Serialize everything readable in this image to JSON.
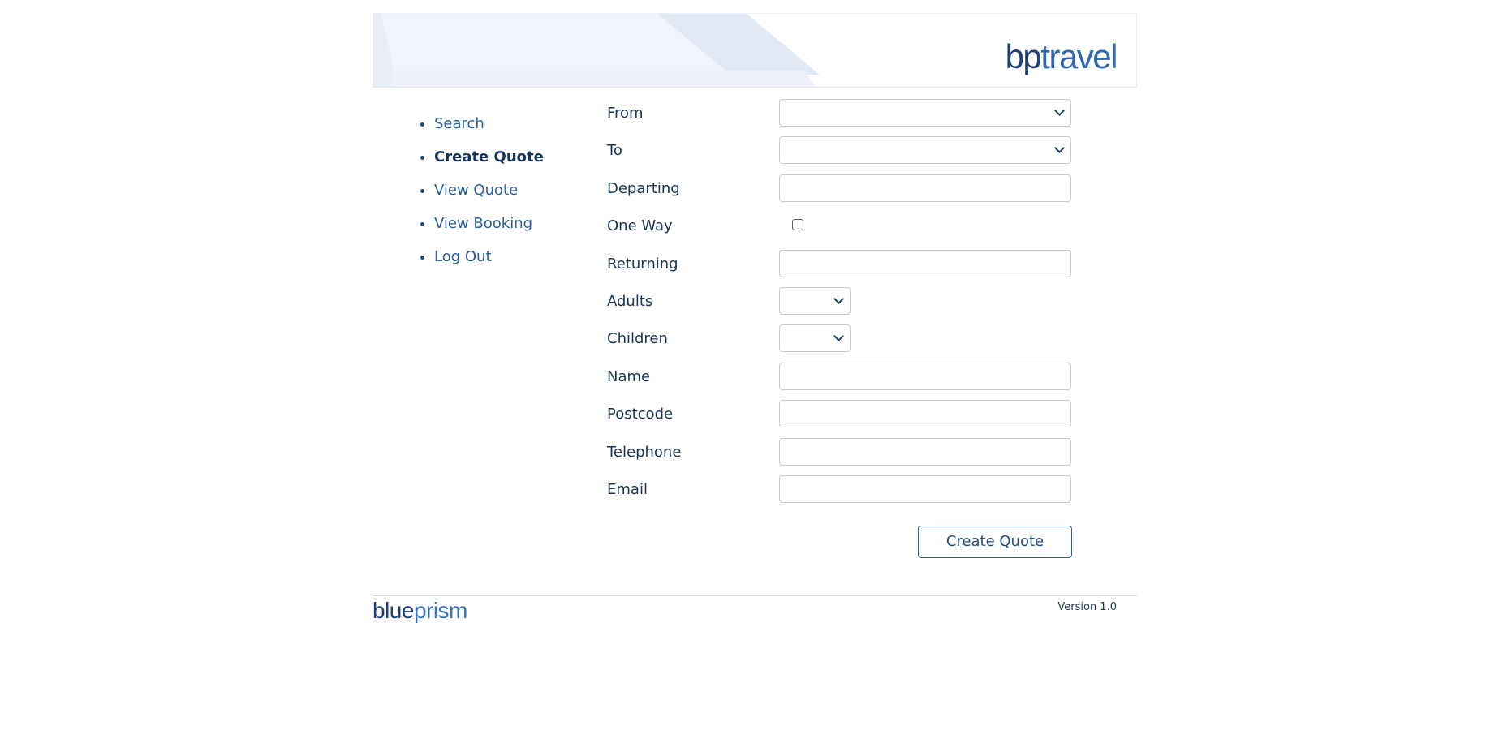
{
  "brand": {
    "part1": "bp",
    "part2": "travel"
  },
  "nav": {
    "items": [
      {
        "label": "Search",
        "active": false
      },
      {
        "label": "Create Quote",
        "active": true
      },
      {
        "label": "View Quote",
        "active": false
      },
      {
        "label": "View Booking",
        "active": false
      },
      {
        "label": "Log Out",
        "active": false
      }
    ]
  },
  "form": {
    "fields": [
      {
        "label": "From",
        "type": "select",
        "value": ""
      },
      {
        "label": "To",
        "type": "select",
        "value": ""
      },
      {
        "label": "Departing",
        "type": "text",
        "value": ""
      },
      {
        "label": "One Way",
        "type": "checkbox",
        "checked": false
      },
      {
        "label": "Returning",
        "type": "text",
        "value": ""
      },
      {
        "label": "Adults",
        "type": "select-small",
        "value": ""
      },
      {
        "label": "Children",
        "type": "select-small",
        "value": ""
      },
      {
        "label": "Name",
        "type": "text",
        "value": ""
      },
      {
        "label": "Postcode",
        "type": "text",
        "value": ""
      },
      {
        "label": "Telephone",
        "type": "text",
        "value": ""
      },
      {
        "label": "Email",
        "type": "text",
        "value": ""
      }
    ],
    "submit_label": "Create Quote"
  },
  "footer": {
    "logo_part1": "blue",
    "logo_part2": "prism",
    "version": "Version 1.0"
  },
  "colors": {
    "brand_dark": "#1b3f7a",
    "brand_light": "#2f66ad",
    "link": "#2a5f97"
  }
}
